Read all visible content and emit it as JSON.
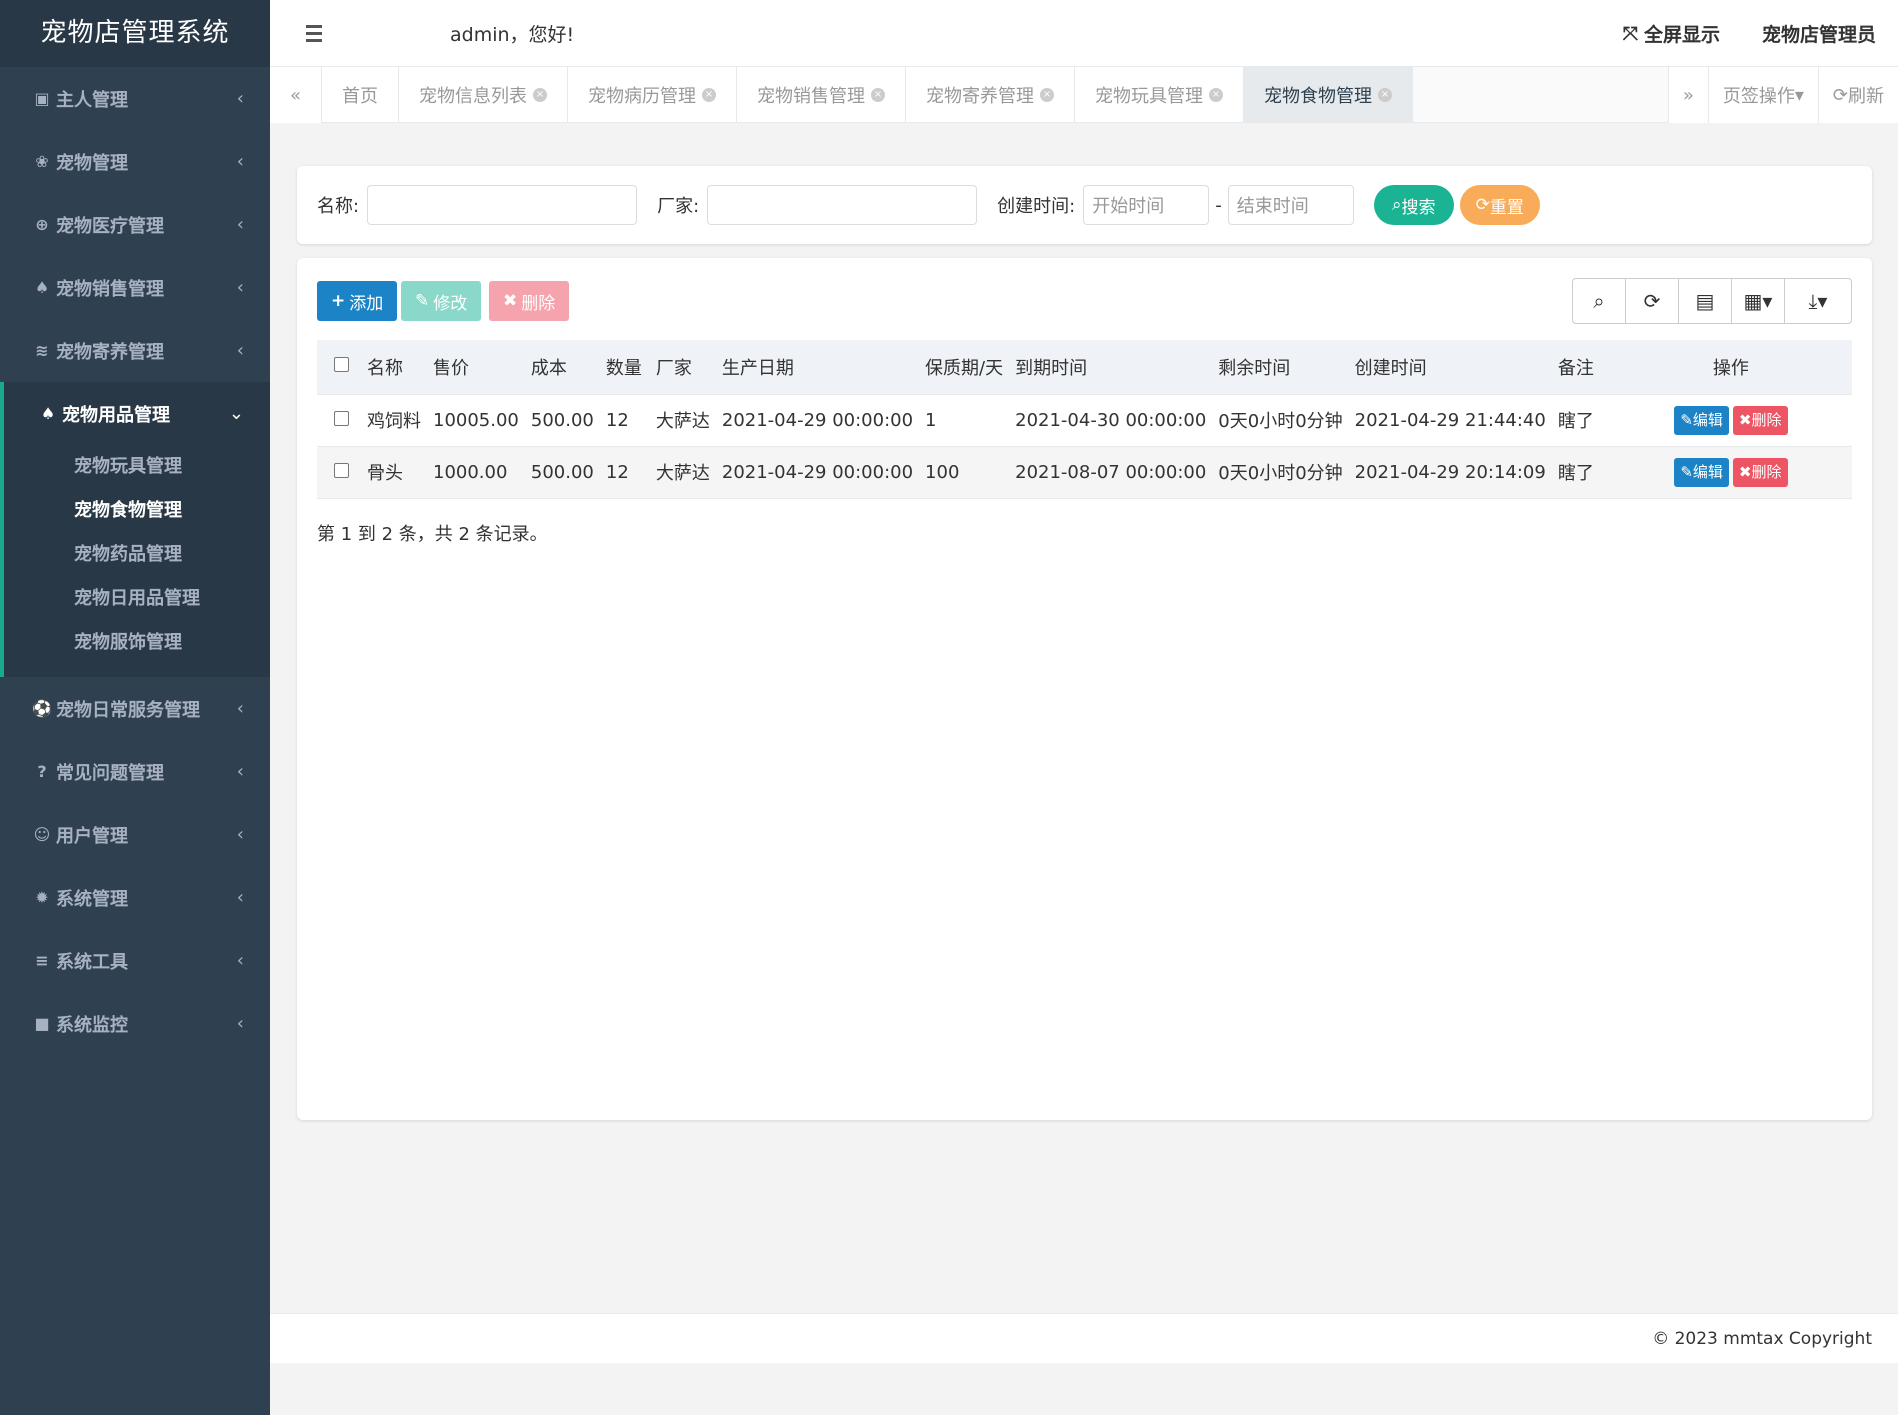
{
  "app": {
    "brand": "宠物店管理系统"
  },
  "sidebar": {
    "items": [
      {
        "icon": "id-card-icon",
        "glyph": "▣",
        "label": "主人管理"
      },
      {
        "icon": "paw-icon",
        "glyph": "❀",
        "label": "宠物管理"
      },
      {
        "icon": "plus-circle-icon",
        "glyph": "⊕",
        "label": "宠物医疗管理"
      },
      {
        "icon": "bell-icon",
        "glyph": "♠",
        "label": "宠物销售管理"
      },
      {
        "icon": "wifi-icon",
        "glyph": "≋",
        "label": "宠物寄养管理"
      }
    ],
    "open_group": {
      "icon": "bell-icon",
      "label": "宠物用品管理",
      "children": [
        "宠物玩具管理",
        "宠物食物管理",
        "宠物药品管理",
        "宠物日用品管理",
        "宠物服饰管理"
      ],
      "active_child": "宠物食物管理"
    },
    "items_after": [
      {
        "icon": "soccer-ball-icon",
        "glyph": "⚽",
        "label": "宠物日常服务管理"
      },
      {
        "icon": "question-circle-icon",
        "glyph": "?",
        "label": "常见问题管理"
      },
      {
        "icon": "user-circle-icon",
        "glyph": "☺",
        "label": "用户管理"
      },
      {
        "icon": "gear-icon",
        "glyph": "✹",
        "label": "系统管理"
      },
      {
        "icon": "list-icon",
        "glyph": "≡",
        "label": "系统工具"
      },
      {
        "icon": "video-camera-icon",
        "glyph": "■",
        "label": "系统监控"
      }
    ]
  },
  "header": {
    "greeting": "admin，您好!",
    "fullscreen": "全屏显示",
    "role": "宠物店管理员"
  },
  "tabs": {
    "items": [
      "首页",
      "宠物信息列表",
      "宠物病历管理",
      "宠物销售管理",
      "宠物寄养管理",
      "宠物玩具管理",
      "宠物食物管理"
    ],
    "active": "宠物食物管理",
    "page_ops": "页签操作",
    "refresh": "刷新"
  },
  "search": {
    "name_label": "名称:",
    "vendor_label": "厂家:",
    "created_label": "创建时间:",
    "start_placeholder": "开始时间",
    "end_placeholder": "结束时间",
    "dash": "-",
    "search_btn": "搜索",
    "reset_btn": "重置"
  },
  "toolbar": {
    "add": "添加",
    "edit": "修改",
    "delete": "删除"
  },
  "table": {
    "headers": [
      "名称",
      "售价",
      "成本",
      "数量",
      "厂家",
      "生产日期",
      "保质期/天",
      "到期时间",
      "剩余时间",
      "创建时间",
      "备注",
      "操作"
    ],
    "rows": [
      [
        "鸡饲料",
        "10005.00",
        "500.00",
        "12",
        "大萨达",
        "2021-04-29 00:00:00",
        "1",
        "2021-04-30 00:00:00",
        "0天0小时0分钟",
        "2021-04-29 21:44:40",
        "瞎了"
      ],
      [
        "骨头",
        "1000.00",
        "500.00",
        "12",
        "大萨达",
        "2021-04-29 00:00:00",
        "100",
        "2021-08-07 00:00:00",
        "0天0小时0分钟",
        "2021-04-29 20:14:09",
        "瞎了"
      ]
    ],
    "row_edit": "编辑",
    "row_delete": "删除",
    "pager": "第 1 到 2 条，共 2 条记录。"
  },
  "footer": {
    "copyright": "© 2023 mmtax Copyright"
  },
  "colors": {
    "sidebar": "#2f4050",
    "primary": "#1c84c6",
    "success": "#1ab394",
    "warning": "#f8ac59",
    "danger": "#ed5565",
    "info": "#23c6c8"
  }
}
